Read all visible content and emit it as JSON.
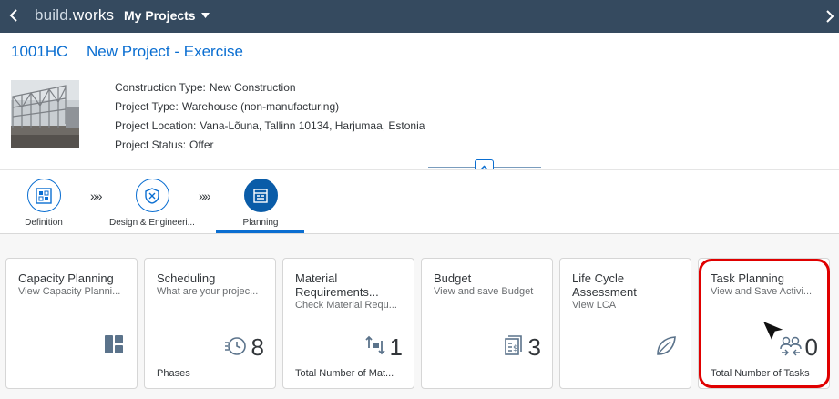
{
  "shell": {
    "brand_prefix": "build.",
    "brand_suffix": "works",
    "menu_label": "My Projects"
  },
  "project": {
    "code": "1001HC",
    "name": "New Project - Exercise",
    "attributes": [
      {
        "key": "Construction Type:",
        "value": "New Construction"
      },
      {
        "key": "Project Type:",
        "value": "Warehouse (non-manufacturing)"
      },
      {
        "key": "Project Location:",
        "value": "Vana-Lõuna, Tallinn 10134, Harjumaa, Estonia"
      },
      {
        "key": "Project Status:",
        "value": "Offer"
      }
    ]
  },
  "flow": {
    "steps": [
      {
        "label": "Definition",
        "icon": "definition-icon"
      },
      {
        "label": "Design & Engineeri...",
        "icon": "design-shield-icon"
      },
      {
        "label": "Planning",
        "icon": "planning-icon"
      }
    ],
    "separator": "»»"
  },
  "tiles": [
    {
      "title": "Capacity Planning",
      "subtitle": "View Capacity Planni...",
      "number": "",
      "footer": "",
      "icon": "capacity-icon"
    },
    {
      "title": "Scheduling",
      "subtitle": "What are your projec...",
      "number": "8",
      "footer": "Phases",
      "icon": "scheduling-icon"
    },
    {
      "title": "Material Requirements...",
      "subtitle": "Check Material Requ...",
      "number": "1",
      "footer": "Total Number of Mat...",
      "icon": "material-sort-icon"
    },
    {
      "title": "Budget",
      "subtitle": "View and save Budget",
      "number": "3",
      "footer": "",
      "icon": "budget-icon"
    },
    {
      "title": "Life Cycle Assessment",
      "subtitle": "View LCA",
      "number": "",
      "footer": "",
      "icon": "leaf-icon"
    },
    {
      "title": "Task Planning",
      "subtitle": "View and Save Activi...",
      "number": "0",
      "footer": "Total Number of Tasks",
      "icon": "task-people-icon"
    }
  ],
  "colors": {
    "shell": "#354a5f",
    "accent": "#0a6ed1",
    "highlight": "#e00000"
  }
}
